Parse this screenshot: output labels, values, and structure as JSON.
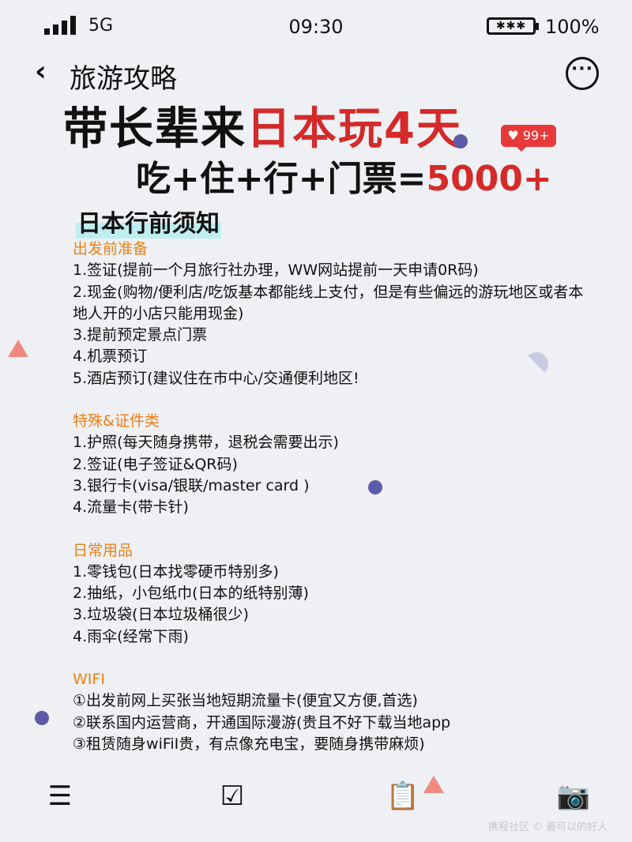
{
  "status_bar": {
    "network": "5G",
    "time": "09:30",
    "battery_icon": "✱✱✱",
    "battery_percent": "100%"
  },
  "nav": {
    "back_icon": "‹",
    "title": "旅游攻略",
    "more_icon": "···"
  },
  "hero": {
    "line1_black": "带长辈来",
    "line1_red": "日本玩4天",
    "line2_black": "吃+住+行+门票=",
    "line2_red": "5000+"
  },
  "like_badge": {
    "icon": "♥",
    "count": "99+"
  },
  "section_title": "日本行前须知",
  "sections": [
    {
      "title": "出发前准备",
      "items": [
        "1.签证(提前一个月旅行社办理，WW网站提前一天申请0R码)",
        "2.现金(购物/便利店/吃饭基本都能线上支付，但是有些偏远的游玩地区或者本地人开的小店只能用现金)",
        "3.提前预定景点门票",
        "4.机票预订",
        "5.酒店预订(建议住在市中心/交通便利地区!"
      ]
    },
    {
      "title": "特殊&证件类",
      "items": [
        "1.护照(每天随身携带，退税会需要出示)",
        "2.签证(电子签证&QR码)",
        "3.银行卡(visa/银联/master card )",
        "4.流量卡(带卡针)"
      ]
    },
    {
      "title": "日常用品",
      "items": [
        "1.零钱包(日本找零硬币特别多)",
        "2.抽纸，小包纸巾(日本的纸特别薄)",
        "3.垃圾袋(日本垃圾桶很少)",
        "4.雨伞(经常下雨)"
      ]
    },
    {
      "title": "WIFI",
      "items": [
        "①出发前网上买张当地短期流量卡(便宜又方便,首选)",
        "②联系国内运营商，开通国际漫游(贵且不好下载当地app",
        "③租赁随身wiFiI贵，有点像充电宝，要随身携带麻烦)"
      ]
    }
  ],
  "bottom_bar": {
    "menu_icon": "☰",
    "checklist_icon": "☑",
    "clipboard_icon": "📋",
    "camera_icon": "📷"
  },
  "watermark": "携程社区 © 最可以的好人",
  "colors": {
    "accent_red": "#d42a2a",
    "category_orange": "#f07f14",
    "highlight_cyan": "#bfeef0",
    "background": "#eef0f3"
  }
}
